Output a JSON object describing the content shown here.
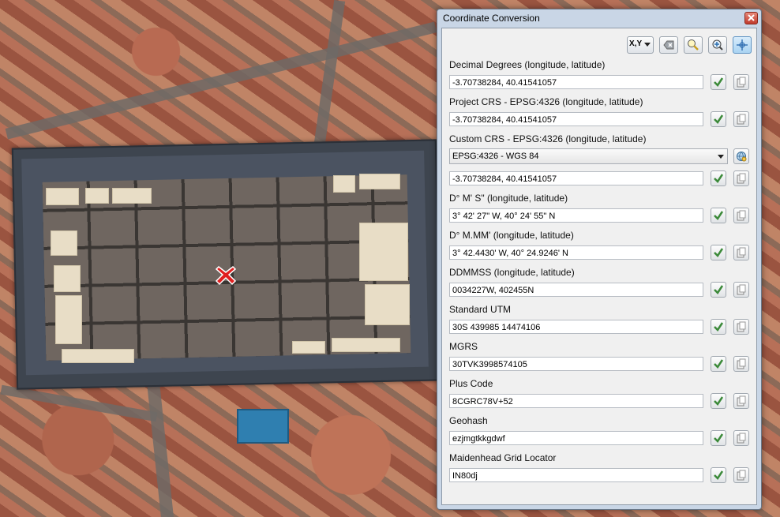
{
  "dialog": {
    "title": "Coordinate Conversion",
    "toolbar": {
      "xy_label": "X,Y"
    },
    "sections": [
      {
        "label": "Decimal Degrees (longitude, latitude)",
        "value": "-3.70738284, 40.41541057"
      },
      {
        "label": "Project CRS - EPSG:4326 (longitude, latitude)",
        "value": "-3.70738284, 40.41541057"
      },
      {
        "label": "Custom CRS - EPSG:4326 (longitude, latitude)",
        "value": "-3.70738284, 40.41541057",
        "select": "EPSG:4326 - WGS 84"
      },
      {
        "label": "D° M' S\" (longitude, latitude)",
        "value": "3° 42' 27\" W, 40° 24' 55\" N"
      },
      {
        "label": "D° M.MM' (longitude, latitude)",
        "value": "3° 42.4430' W, 40° 24.9246' N"
      },
      {
        "label": "DDMMSS (longitude, latitude)",
        "value": "0034227W, 402455N"
      },
      {
        "label": "Standard UTM",
        "value": "30S 439985 14474106"
      },
      {
        "label": "MGRS",
        "value": "30TVK3998574105"
      },
      {
        "label": "Plus Code",
        "value": "8CGRC78V+52"
      },
      {
        "label": "Geohash",
        "value": "ezjmgtkkgdwf"
      },
      {
        "label": "Maidenhead Grid Locator",
        "value": "IN80dj"
      }
    ]
  },
  "colors": {
    "accent_check": "#3c8a3a",
    "marker": "#e02020",
    "dialog_frame": "#c9d6e6"
  },
  "icons": [
    "close-icon",
    "xy-dropdown-icon",
    "clear-icon",
    "zoom-icon",
    "add-icon",
    "crosshair-icon",
    "check-icon",
    "copy-icon",
    "crs-select-icon",
    "location-marker-icon"
  ]
}
